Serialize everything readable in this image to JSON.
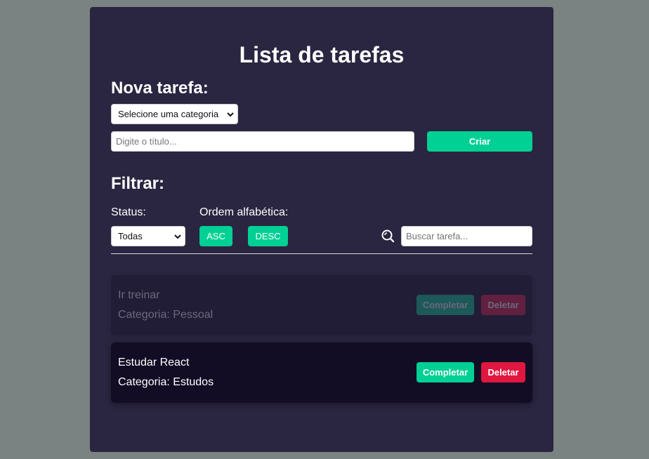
{
  "app": {
    "title": "Lista de tarefas"
  },
  "new_task": {
    "heading": "Nova tarefa:",
    "category_select_value": "Selecione uma categoria",
    "title_placeholder": "Digite o título...",
    "create_label": "Criar"
  },
  "filter": {
    "heading": "Filtrar:",
    "status_label": "Status:",
    "status_value": "Todas",
    "order_label": "Ordem alfabética:",
    "asc_label": "ASC",
    "desc_label": "DESC",
    "search_placeholder": "Buscar tarefa...",
    "search_icon": "magnifier-icon"
  },
  "tasks": [
    {
      "title": "Ir treinar",
      "category": "Categoria: Pessoal",
      "completed": true,
      "complete_label": "Completar",
      "delete_label": "Deletar"
    },
    {
      "title": "Estudar React",
      "category": "Categoria: Estudos",
      "completed": false,
      "complete_label": "Completar",
      "delete_label": "Deletar"
    }
  ],
  "colors": {
    "background": "#7a8282",
    "card": "#2a2540",
    "task": "#120c24",
    "accent": "#00d094",
    "danger": "#e0173f"
  }
}
